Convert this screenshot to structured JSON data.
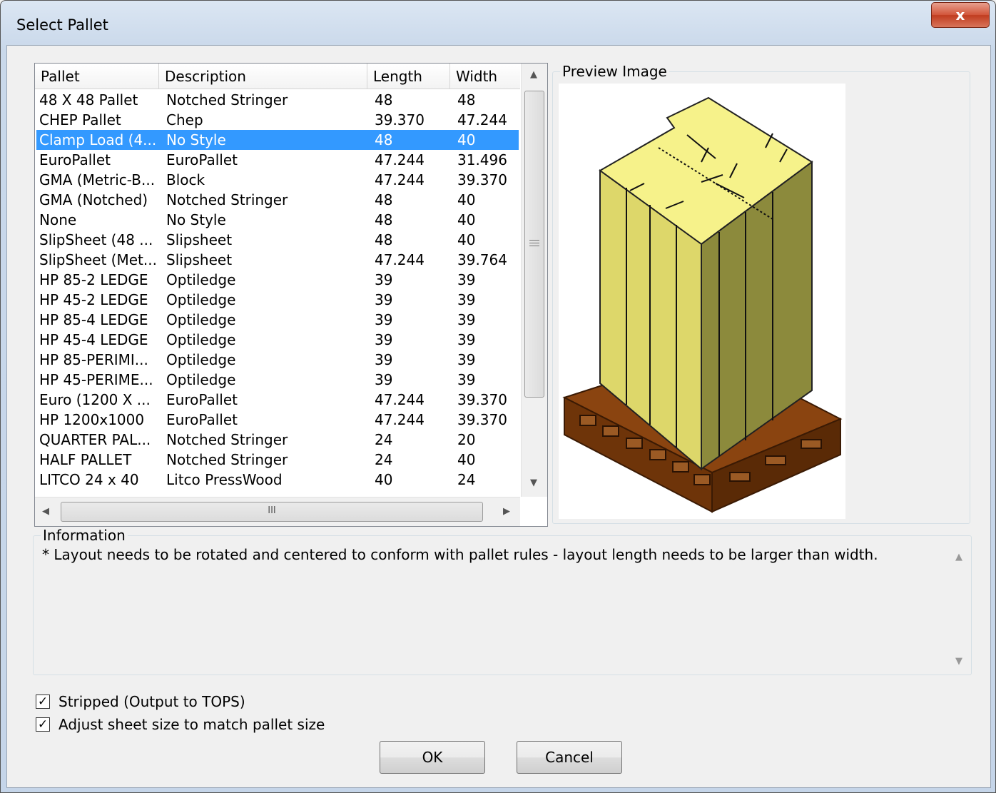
{
  "window": {
    "title": "Select Pallet",
    "close_glyph": "x"
  },
  "list": {
    "columns": [
      "Pallet",
      "Description",
      "Length",
      "Width"
    ],
    "rows": [
      [
        "48 X 48 Pallet",
        "Notched Stringer",
        "48",
        "48"
      ],
      [
        "CHEP Pallet",
        "Chep",
        "39.370",
        "47.244"
      ],
      [
        "Clamp Load (4...",
        "No Style",
        "48",
        "40"
      ],
      [
        "EuroPallet",
        "EuroPallet",
        "47.244",
        "31.496"
      ],
      [
        "GMA (Metric-B...",
        "Block",
        "47.244",
        "39.370"
      ],
      [
        "GMA (Notched)",
        "Notched Stringer",
        "48",
        "40"
      ],
      [
        "None",
        "No Style",
        "48",
        "40"
      ],
      [
        "SlipSheet (48 ...",
        "Slipsheet",
        "48",
        "40"
      ],
      [
        "SlipSheet (Met...",
        "Slipsheet",
        "47.244",
        "39.764"
      ],
      [
        "HP 85-2 LEDGE",
        "Optiledge",
        "39",
        "39"
      ],
      [
        "HP 45-2 LEDGE",
        "Optiledge",
        "39",
        "39"
      ],
      [
        "HP 85-4 LEDGE",
        "Optiledge",
        "39",
        "39"
      ],
      [
        "HP 45-4 LEDGE",
        "Optiledge",
        "39",
        "39"
      ],
      [
        "HP 85-PERIMI...",
        "Optiledge",
        "39",
        "39"
      ],
      [
        "HP 45-PERIME...",
        "Optiledge",
        "39",
        "39"
      ],
      [
        "Euro (1200 X ...",
        "EuroPallet",
        "47.244",
        "39.370"
      ],
      [
        "HP 1200x1000",
        "EuroPallet",
        "47.244",
        "39.370"
      ],
      [
        "QUARTER PAL...",
        "Notched Stringer",
        "24",
        "20"
      ],
      [
        "HALF PALLET",
        "Notched Stringer",
        "24",
        "40"
      ],
      [
        "LITCO 24 x 40",
        "Litco PressWood",
        "40",
        "24"
      ]
    ],
    "selected_index": 2,
    "hscroll_glyph": "III"
  },
  "preview": {
    "label": "Preview Image"
  },
  "information": {
    "label": "Information",
    "text": "* Layout needs to be rotated and centered to conform with pallet rules - layout length needs to be larger than width."
  },
  "options": {
    "stripped": {
      "label": "Stripped (Output to TOPS)",
      "checked": true
    },
    "adjust_sheet": {
      "label": "Adjust sheet size to match pallet size",
      "checked": true
    }
  },
  "buttons": {
    "ok": "OK",
    "cancel": "Cancel"
  },
  "colors": {
    "selection": "#3399ff",
    "load_top": "#f6f28a",
    "load_side": "#ddd76a",
    "pallet": "#7b3a0b"
  }
}
